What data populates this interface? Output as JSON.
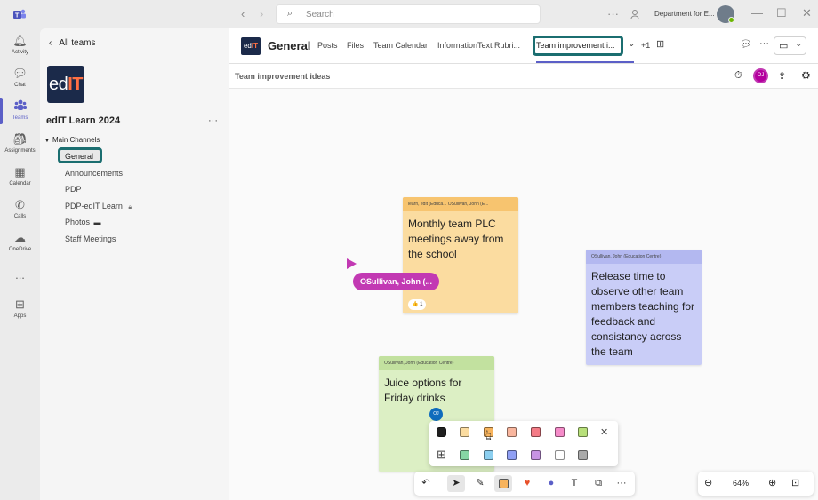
{
  "titlebar": {
    "search_placeholder": "Search",
    "org_name": "Department for E..."
  },
  "rail": {
    "items": [
      {
        "label": "Activity",
        "icon": "bell-icon"
      },
      {
        "label": "Chat",
        "icon": "chat-icon"
      },
      {
        "label": "Teams",
        "icon": "teams-icon"
      },
      {
        "label": "Assignments",
        "icon": "backpack-icon"
      },
      {
        "label": "Calendar",
        "icon": "calendar-icon"
      },
      {
        "label": "Calls",
        "icon": "phone-icon"
      },
      {
        "label": "OneDrive",
        "icon": "cloud-icon"
      },
      {
        "label": "...",
        "icon": "more-icon"
      },
      {
        "label": "Apps",
        "icon": "add-app-icon"
      }
    ],
    "active": "Teams"
  },
  "leftpanel": {
    "back_label": "All teams",
    "team_logo_text_1": "ed",
    "team_logo_text_2": "IT",
    "team_name": "edIT Learn 2024",
    "section_label": "Main Channels",
    "channels": [
      "General",
      "Announcements",
      "PDP",
      "PDP-edIT Learn",
      "Photos",
      "Staff Meetings"
    ]
  },
  "channel_header": {
    "title": "General",
    "tabs": [
      "Posts",
      "Files",
      "Team Calendar",
      "InformationText Rubri...",
      "Team improvement i..."
    ],
    "more_tabs": "+1"
  },
  "whiteboard": {
    "title": "Team improvement ideas",
    "avatar_initials": "OJ",
    "zoom": "64%"
  },
  "notes": [
    {
      "author": "learn, edit (Educa...   OSullivan, John (E...",
      "text": "Monthly team PLC meetings away from the school",
      "reaction": "👍 1",
      "color": "#fbdca0",
      "header_color": "#f7c46f"
    },
    {
      "author": "OSullivan, John (Education Centre)",
      "text": "Release time to observe other team members teaching for feedback and consistancy across the team",
      "color": "#c9cdf7",
      "header_color": "#b3b8f0"
    },
    {
      "author": "OSullivan, John (Education Centre)",
      "text": "Juice options for Friday drinks",
      "color": "#dcefc4",
      "header_color": "#c2e19f"
    }
  ],
  "cursor_tag": "OSullivan, John (...",
  "note_badge": "OJ",
  "palette": {
    "row1": [
      "#1f1f1f",
      "#fbdca0",
      "#f7b35c",
      "#f9b69e",
      "#f47b86",
      "#f58bc9",
      "#b8e07a"
    ],
    "row2": [
      "#grid",
      "#86d6a4",
      "#8ccff0",
      "#8f9ff4",
      "#c793e3",
      "#ffffff",
      "#a9a9a9"
    ]
  }
}
